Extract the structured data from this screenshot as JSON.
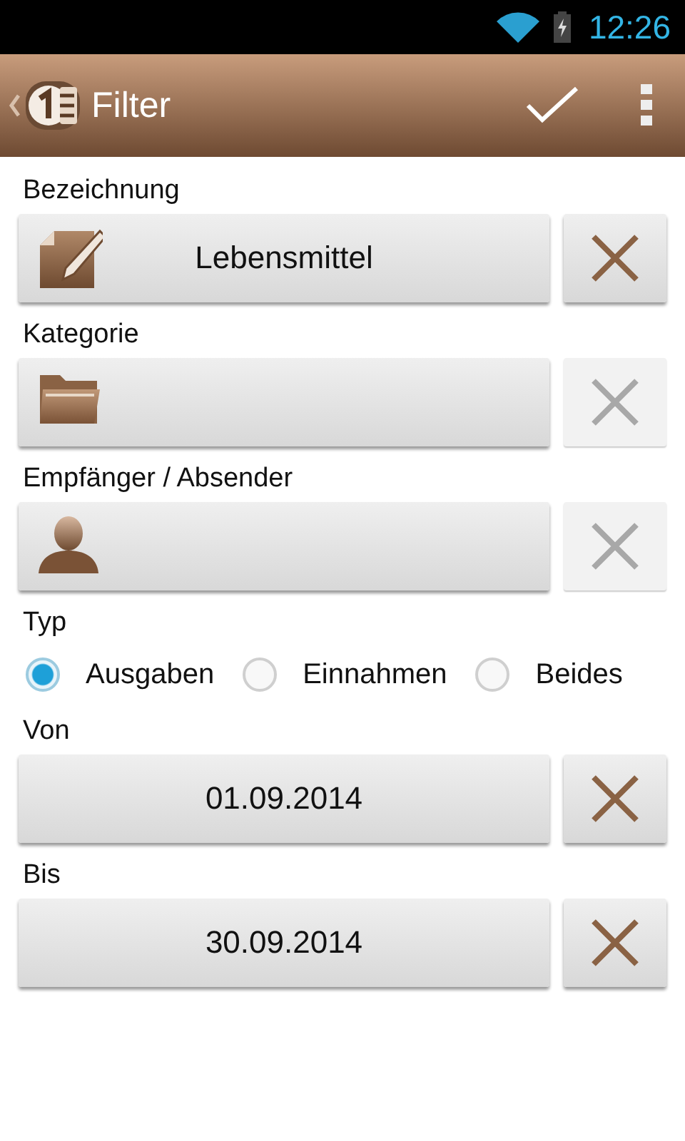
{
  "status_bar": {
    "time": "12:26"
  },
  "action_bar": {
    "title": "Filter"
  },
  "sections": [
    {
      "kind": "name",
      "label": "Bezeichnung",
      "value": "Lebensmittel",
      "clear_disabled": false
    },
    {
      "kind": "category",
      "label": "Kategorie",
      "clear_disabled": true
    },
    {
      "kind": "contact",
      "label": "Empfänger / Absender",
      "clear_disabled": true
    },
    {
      "kind": "radio",
      "label": "Typ",
      "options": [
        {
          "label": "Ausgaben",
          "selected": true
        },
        {
          "label": "Einnahmen",
          "selected": false
        },
        {
          "label": "Beides",
          "selected": false
        }
      ]
    },
    {
      "kind": "date",
      "label": "Von",
      "value": "01.09.2014",
      "clear_disabled": false
    },
    {
      "kind": "date",
      "label": "Bis",
      "value": "30.09.2014",
      "clear_disabled": false
    }
  ]
}
